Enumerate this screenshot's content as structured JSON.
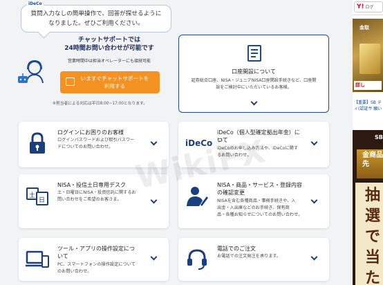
{
  "tooltip": {
    "tag": "iDeCo",
    "line1": "質問入力なしの簡単操作で、回答が探せるように",
    "line2": "なりました。ぜひご利用ください。"
  },
  "chat": {
    "title1": "チャットサポートでは",
    "title2": "24時間お問い合わせが可能です",
    "hours": "営業時間中は担当オペレーターにも接続可能",
    "button_line1": "いますぐチャットサポートを",
    "button_line2": "利用する",
    "note": "※担当者による対応は平日8:00~17:00となります。"
  },
  "account": {
    "title": "口座開設について",
    "desc1": "証券総合口座、NISA・ジュニアNISA口座開設手続きなど、口座開",
    "desc2": "設をご検討中にいただいているお客様。"
  },
  "cards": [
    {
      "title1": "ログインにお困りのお客様",
      "title2": "",
      "desc1": "ログインパスワードおよび取引パスワー",
      "desc2": "ドについてのお問い合わせ。",
      "desc3": ""
    },
    {
      "title1": "iDeCo（個人型確定拠出年金）につ",
      "title2": "いて",
      "desc1": "iDeCoのお申し込み方法や、iDeCoに関す",
      "desc2": "るお問い合わせ。",
      "desc3": ""
    },
    {
      "title1": "NISA・投信土日専用デスク",
      "title2": "",
      "desc1": "土・日曜日にNISA・投資信託に関するお",
      "desc2": "問い合わせをご希望のお客さま。",
      "desc3": ""
    },
    {
      "title1": "NISA・商品・サービス・登録内容",
      "title2": "の確認変更",
      "desc1": "NISAを含む各種商品・事務手続きや、入",
      "desc2": "出金・入出庫などのお手続き、保有商",
      "desc3": "品・各種お知らせについてのお問い合わせ。"
    },
    {
      "title1": "ツール・アプリの操作設定につ",
      "title2": "いて",
      "desc1": "PC、スマートフォンの操作設定について",
      "desc2": "のお問い合わせ。",
      "desc3": ""
    },
    {
      "title1": "電話でのご注文",
      "title2": "",
      "desc1": "お電話での注文発注を承ります。",
      "desc2": "",
      "desc3": ""
    }
  ],
  "ideco_logo": "iDeCo",
  "sidebar": {
    "yahoo_label": "ログ",
    "gold_ad_title": "金取",
    "gold_ad_button": "詳し",
    "notice": "【重要】SB ティ(認証サ 願い",
    "lottery_header": "SB",
    "lottery_gold": "金商品先",
    "lottery_big": "抽選で当た"
  },
  "watermark": "WikiFX",
  "colors": {
    "accent": "#f39223",
    "navy": "#1a4a95",
    "link": "#0a4aa8"
  }
}
